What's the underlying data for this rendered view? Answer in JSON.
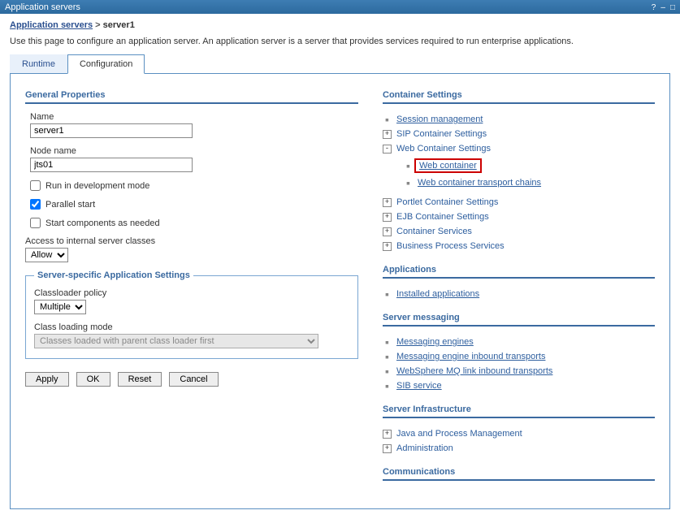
{
  "titlebar": {
    "title": "Application servers"
  },
  "breadcrumb": {
    "parent": "Application servers",
    "sep": ">",
    "current": "server1"
  },
  "description": "Use this page to configure an application server. An application server is a server that provides services required to run enterprise applications.",
  "tabs": {
    "runtime": "Runtime",
    "configuration": "Configuration"
  },
  "general": {
    "heading": "General Properties",
    "name_label": "Name",
    "name_value": "server1",
    "node_label": "Node name",
    "node_value": "jts01",
    "dev_mode": "Run in development mode",
    "parallel": "Parallel start",
    "start_comp": "Start components as needed",
    "access_label": "Access to internal server classes",
    "access_value": "Allow"
  },
  "server_specific": {
    "legend": "Server-specific Application Settings",
    "classloader_label": "Classloader policy",
    "classloader_value": "Multiple",
    "loading_label": "Class loading mode",
    "loading_value": "Classes loaded with parent class loader first"
  },
  "buttons": {
    "apply": "Apply",
    "ok": "OK",
    "reset": "Reset",
    "cancel": "Cancel"
  },
  "container": {
    "heading": "Container Settings",
    "session": "Session management",
    "sip": "SIP Container Settings",
    "web": "Web Container Settings",
    "web_container": "Web container",
    "web_transport": "Web container transport chains",
    "portlet": "Portlet Container Settings",
    "ejb": "EJB Container Settings",
    "services": "Container Services",
    "bps": "Business Process Services"
  },
  "applications": {
    "heading": "Applications",
    "installed": "Installed applications"
  },
  "messaging": {
    "heading": "Server messaging",
    "engines": "Messaging engines",
    "inbound": "Messaging engine inbound transports",
    "mq": "WebSphere MQ link inbound transports",
    "sib": "SIB service"
  },
  "infra": {
    "heading": "Server Infrastructure",
    "java": "Java and Process Management",
    "admin": "Administration"
  },
  "comm": {
    "heading": "Communications"
  }
}
